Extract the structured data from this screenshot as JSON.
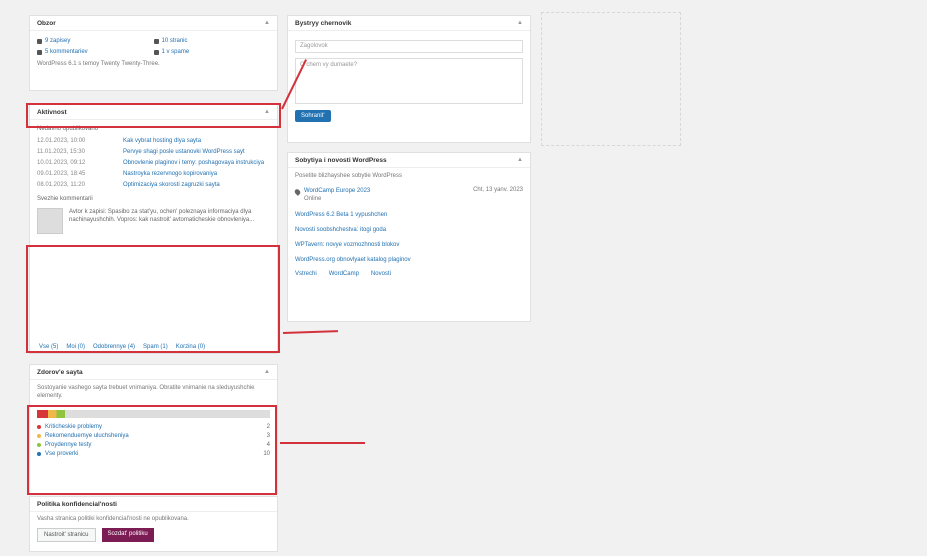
{
  "glance": {
    "title": "Obzor",
    "items": [
      "9 zapisey",
      "10 stranic",
      "5 kommentariev",
      "1 v spame"
    ],
    "footer": "WordPress 6.1 s temoy Twenty Twenty-Three."
  },
  "activity": {
    "title": "Aktivnost",
    "recently_published": "Nedavno opublikovano",
    "posts": [
      {
        "date": "12.01.2023, 10:00",
        "title": "Kak vybrat hosting dlya sayta"
      },
      {
        "date": "11.01.2023, 15:30",
        "title": "Pervye shagi posle ustanovki WordPress sayt"
      },
      {
        "date": "10.01.2023, 09:12",
        "title": "Obnovlenie plaginov i temy: poshagovaya instrukciya"
      },
      {
        "date": "09.01.2023, 18:45",
        "title": "Nastroyka rezervnogo kopirovaniya"
      },
      {
        "date": "08.01.2023, 11:20",
        "title": "Optimizaciya skorosti zagruzki sayta"
      }
    ],
    "recent_comments": "Svezhie kommentarii",
    "comment_text": "Avtor k zapisi: Spasibo za stat'yu, ochen' poleznaya informaciya dlya nachinayushchih. Vopros: kak nastroit' avtomaticheskie obnovleniya...",
    "comment_links": [
      "Vse (5)",
      "Moi (0)",
      "Odobrennye (4)",
      "Spam (1)",
      "Korzina (0)"
    ]
  },
  "quick_draft": {
    "title": "Bystryy chernovik",
    "title_placeholder": "Zagolovok",
    "content_placeholder": "O chem vy dumaete?",
    "save_label": "Sohranit'"
  },
  "news": {
    "title": "Sobytiya i novosti WordPress",
    "intro": "Posetite blizhayshee sobytie WordPress",
    "event_title": "WordCamp Europe 2023",
    "event_location": "Online",
    "event_date": "Cht, 13 yanv. 2023",
    "headlines": [
      "WordPress 6.2 Beta 1 vypushchen",
      "Novosti soobshchestva: itogi goda",
      "WPTavern: novye vozmozhnosti blokov",
      "WordPress.org obnovlyaet katalog plaginov"
    ],
    "footer_links": [
      "Vstrechi",
      "WordCamp",
      "Novosti"
    ]
  },
  "site_health": {
    "title": "Zdorov'e sayta",
    "description": "Sostoyanie vashego sayta trebuet vnimaniya. Obratite vnimanie na sleduyushchie elementy.",
    "progress_percent": 12,
    "rows": [
      {
        "label": "Kriticheskie problemy",
        "count": "2",
        "color": "#d63638"
      },
      {
        "label": "Rekomenduemye uluchsheniya",
        "count": "3",
        "color": "#f0b849"
      },
      {
        "label": "Proydennye testy",
        "count": "4",
        "color": "#8fc53e"
      },
      {
        "label": "Vse proverki",
        "count": "10",
        "color": "#2271b1"
      }
    ]
  },
  "privacy": {
    "title": "Politika konfidencial'nosti",
    "text": "Vasha stranica politiki konfidencial'nosti ne opublikovana.",
    "btn_secondary": "Nastroit' stranicu",
    "btn_primary": "Sozdat' politiku"
  },
  "colors": {
    "annotation": "#d3323d",
    "accent": "#2271b1"
  }
}
